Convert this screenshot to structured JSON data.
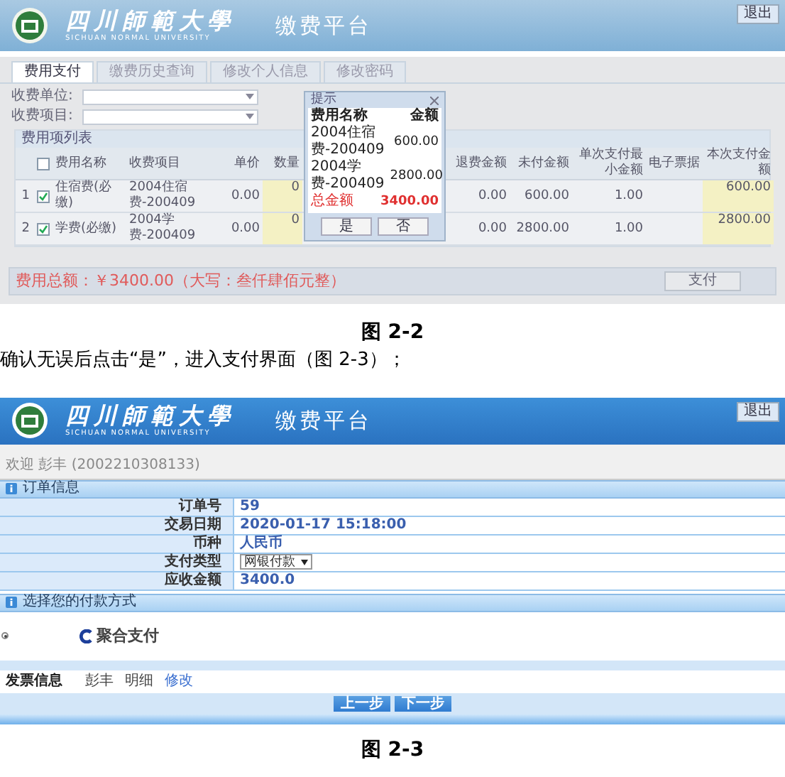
{
  "screen_1": {
    "header": {
      "school_name": "四川師範大學",
      "school_name_en": "SICHUAN NORMAL UNIVERSITY",
      "platform": "缴费平台",
      "exit_button": "退出"
    },
    "tabs": [
      {
        "label": "费用支付",
        "selected": true
      },
      {
        "label": "缴费历史查询",
        "selected": false
      },
      {
        "label": "修改个人信息",
        "selected": false
      },
      {
        "label": "修改密码",
        "selected": false
      }
    ],
    "filters": [
      {
        "label": "收费单位:"
      },
      {
        "label": "收费项目:"
      }
    ],
    "list_title": "费用项列表",
    "table": {
      "all_checked": false,
      "columns": [
        "费用名称",
        "收费项目",
        "单价",
        "数量",
        "退费金额",
        "未付金额",
        "单次支付最小金额",
        "电子票据",
        "本次支付金额"
      ],
      "rows": [
        {
          "index": "1",
          "checked": true,
          "name": "住宿费(必缴)",
          "item": "2004住宿费-200409",
          "unit_price": "0.00",
          "quantity": "0",
          "refund": "0.00",
          "unpaid": "600.00",
          "min_payment": "1.00",
          "pay_amount": "600.00"
        },
        {
          "index": "2",
          "checked": true,
          "name": "学费(必缴)",
          "item": "2004学费-200409",
          "unit_price": "0.00",
          "quantity": "0",
          "refund": "0.00",
          "unpaid": "2800.00",
          "min_payment": "1.00",
          "pay_amount": "2800.00"
        }
      ]
    },
    "dialog": {
      "title": "提示",
      "columns": [
        "费用名称",
        "金额"
      ],
      "rows": [
        {
          "name": "2004住宿费-200409",
          "amount": "600.00"
        },
        {
          "name": "2004学费-200409",
          "amount": "2800.00"
        }
      ],
      "total_label": "总金额",
      "total": "3400.00",
      "buttons": [
        "是",
        "否"
      ]
    },
    "footer": {
      "total": "费用总额：￥3400.00（大写：叁仟肆佰元整）",
      "pay_button": "支付"
    }
  },
  "caption_1": "图 2-2",
  "instruction": "确认无误后点击“是”，进入支付界面（图 2-3）；",
  "screen_2": {
    "header": {
      "school_name": "四川師範大學",
      "school_name_en": "SICHUAN NORMAL UNIVERSITY",
      "platform": "缴费平台",
      "exit_button": "退出"
    },
    "welcome": "欢迎 彭丰 (2002210308133)",
    "order_section": {
      "title": "订单信息",
      "rows": [
        {
          "label": "订单号",
          "value": "59",
          "kind": "text"
        },
        {
          "label": "交易日期",
          "value": "2020-01-17 15:18:00",
          "kind": "text"
        },
        {
          "label": "币种",
          "value": "人民币",
          "kind": "text"
        },
        {
          "label": "支付类型",
          "value": "网银付款",
          "kind": "select"
        },
        {
          "label": "应收金额",
          "value": "3400.0",
          "kind": "text"
        }
      ]
    },
    "payment_section": {
      "title": "选择您的付款方式",
      "options": [
        {
          "label": "聚合支付",
          "selected": true
        }
      ]
    },
    "invoice": {
      "label": "发票信息",
      "name": "彭丰",
      "detail": "明细",
      "edit_link": "修改"
    },
    "buttons": [
      "上一步",
      "下一步"
    ]
  },
  "caption_2": "图 2-3"
}
